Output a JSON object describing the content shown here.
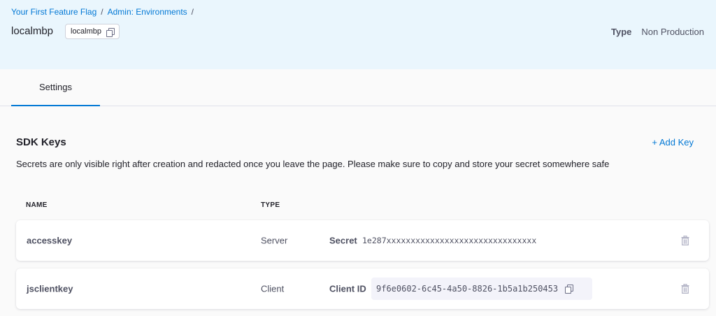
{
  "breadcrumb": [
    {
      "label": "Your First Feature Flag"
    },
    {
      "label": "Admin: Environments"
    }
  ],
  "breadcrumb_separator": "/",
  "environment": {
    "name": "localmbp",
    "identifier": "localmbp",
    "type_label": "Type",
    "type_value": "Non Production"
  },
  "tabs": [
    {
      "label": "Settings",
      "active": true
    }
  ],
  "sdk_keys": {
    "title": "SDK Keys",
    "add_label": "+ Add Key",
    "note": "Secrets are only visible right after creation and redacted once you leave the page. Please make sure to copy and store your secret somewhere safe",
    "columns": {
      "name": "NAME",
      "type": "TYPE"
    },
    "rows": [
      {
        "name": "accesskey",
        "type": "Server",
        "key_label": "Secret",
        "key_value": "1e287xxxxxxxxxxxxxxxxxxxxxxxxxxxxxxx",
        "icon": "trash-icon"
      },
      {
        "name": "jsclientkey",
        "type": "Client",
        "key_label": "Client ID",
        "key_value": "9f6e0602-6c45-4a50-8826-1b5a1b250453",
        "icon": "trash-icon"
      }
    ]
  },
  "colors": {
    "accent": "#0278d5",
    "header_bg": "#eaf6fd",
    "page_bg": "#fafafa"
  }
}
